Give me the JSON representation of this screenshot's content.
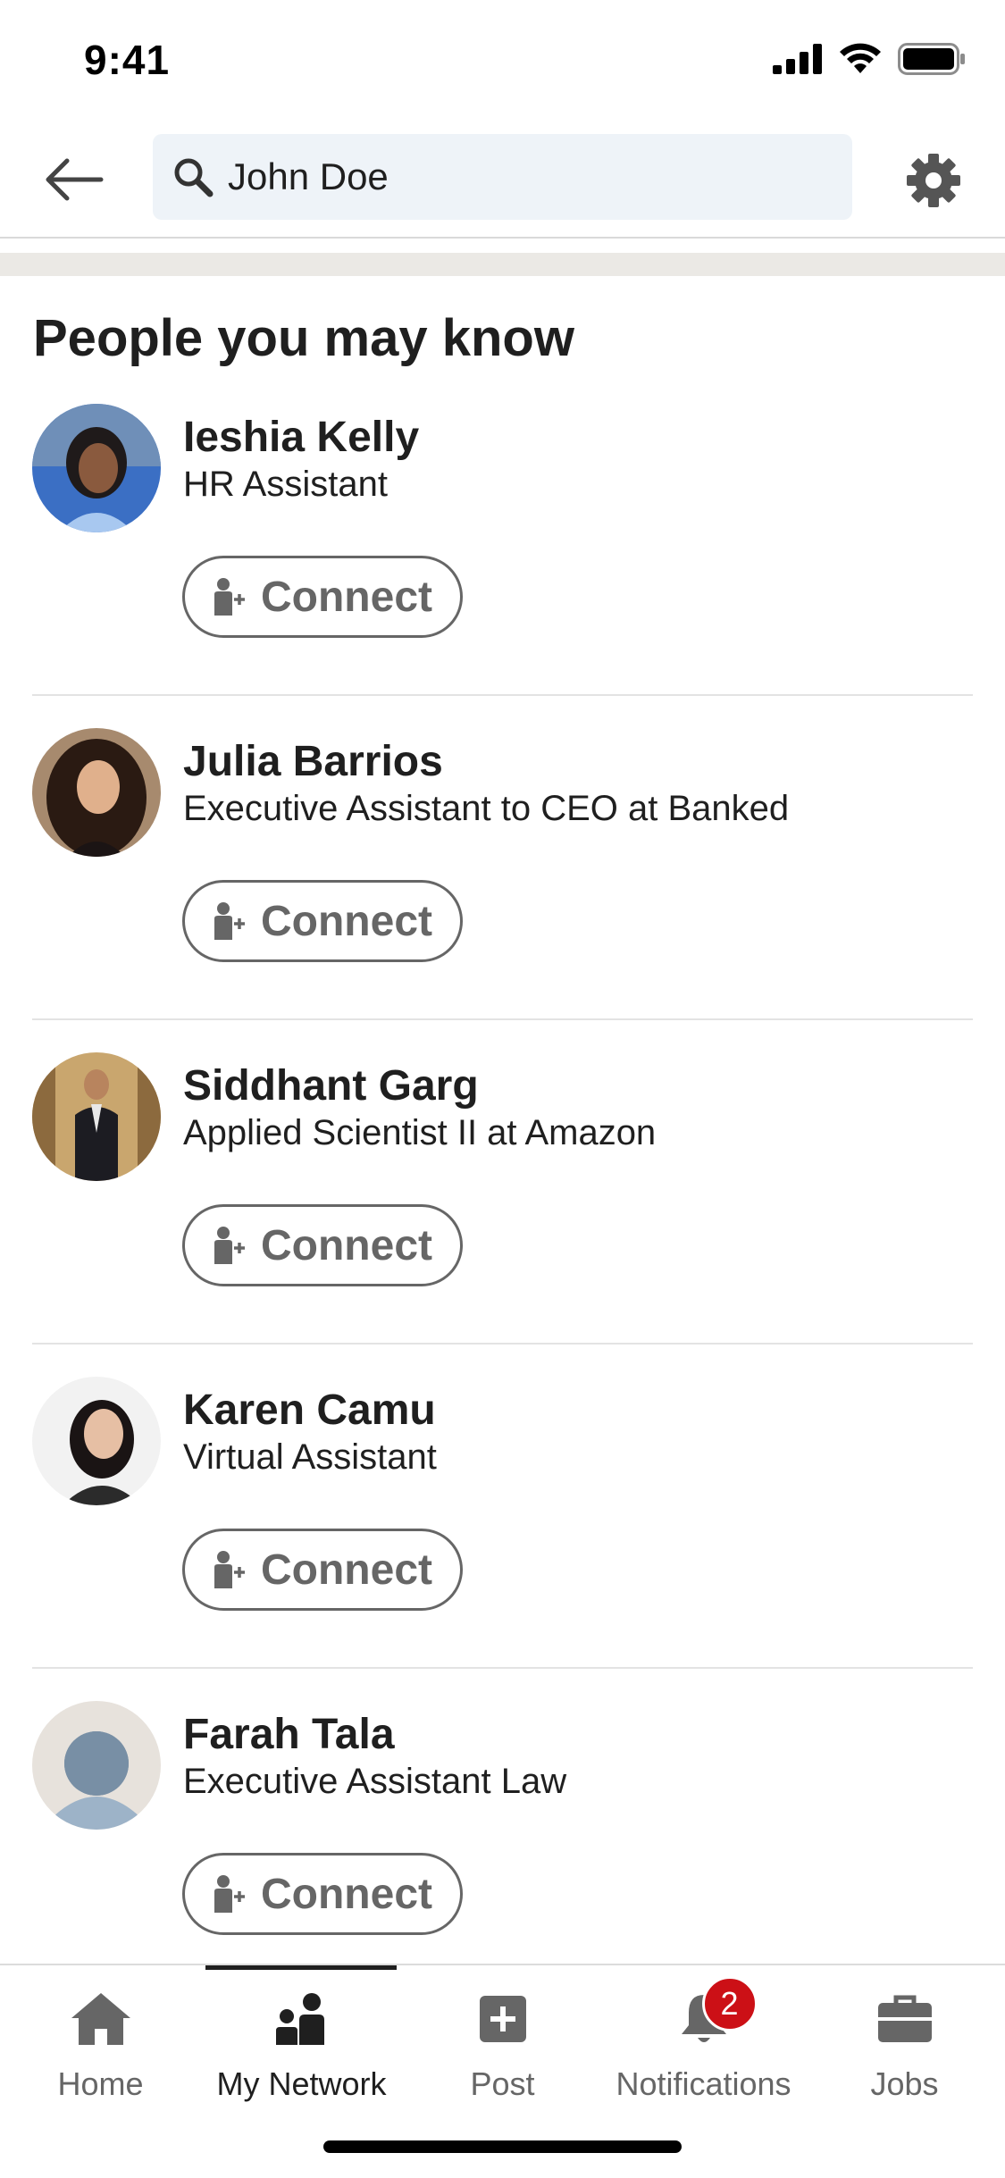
{
  "status_bar": {
    "time": "9:41"
  },
  "search": {
    "query": "John Doe"
  },
  "section_title": "People you may know",
  "people": [
    {
      "name": "Ieshia Kelly",
      "headline": "HR Assistant",
      "connect_label": "Connect"
    },
    {
      "name": "Julia Barrios",
      "headline": "Executive Assistant to CEO at Banked",
      "connect_label": "Connect"
    },
    {
      "name": "Siddhant Garg",
      "headline": "Applied Scientist II at Amazon",
      "connect_label": "Connect"
    },
    {
      "name": "Karen Camu",
      "headline": "Virtual Assistant",
      "connect_label": "Connect"
    },
    {
      "name": "Farah Tala",
      "headline": "Executive Assistant Law",
      "connect_label": "Connect"
    }
  ],
  "bottom_nav": {
    "items": [
      {
        "label": "Home",
        "icon": "home-icon"
      },
      {
        "label": "My Network",
        "icon": "network-icon",
        "active": true
      },
      {
        "label": "Post",
        "icon": "post-icon"
      },
      {
        "label": "Notifications",
        "icon": "bell-icon",
        "badge": "2"
      },
      {
        "label": "Jobs",
        "icon": "briefcase-icon"
      }
    ]
  },
  "colors": {
    "accent_badge": "#cc1016",
    "search_bg": "#eef3f8",
    "muted": "#666666"
  }
}
